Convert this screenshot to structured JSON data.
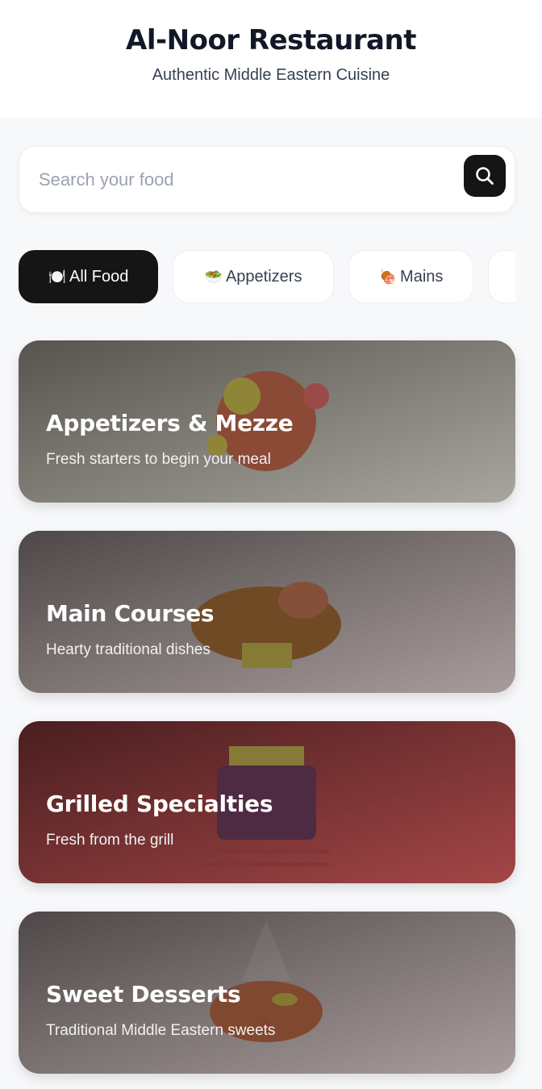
{
  "header": {
    "title": "Al-Noor Restaurant",
    "subtitle": "Authentic Middle Eastern Cuisine"
  },
  "search": {
    "placeholder": "Search your food",
    "button_icon": "search-icon"
  },
  "categories": [
    {
      "emoji": "🍽️",
      "label": "All Food",
      "active": true
    },
    {
      "emoji": "🥗",
      "label": "Appetizers",
      "active": false
    },
    {
      "emoji": "🍖",
      "label": "Mains",
      "active": false
    }
  ],
  "sections": [
    {
      "title": "Appetizers & Mezze",
      "subtitle": "Fresh starters to begin your meal"
    },
    {
      "title": "Main Courses",
      "subtitle": "Hearty traditional dishes"
    },
    {
      "title": "Grilled Specialties",
      "subtitle": "Fresh from the grill"
    },
    {
      "title": "Sweet Desserts",
      "subtitle": "Traditional Middle Eastern sweets"
    }
  ],
  "colors": {
    "accent_dark": "#151515",
    "page_bg": "#f7f8fa"
  }
}
